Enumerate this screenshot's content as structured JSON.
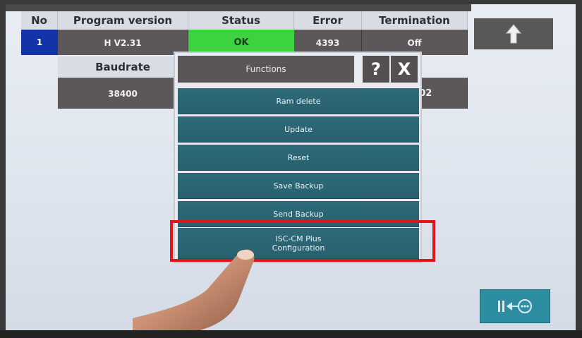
{
  "table": {
    "headers": {
      "no": "No",
      "program_version": "Program version",
      "status": "Status",
      "error": "Error",
      "termination": "Termination"
    },
    "row": {
      "no": "1",
      "program_version": "H V2.31",
      "status": "OK",
      "error": "4393",
      "termination": "Off"
    },
    "baudrate_header": "Baudrate",
    "baudrate_value": "38400",
    "partial_value": ":02"
  },
  "dialog": {
    "title": "Functions",
    "help_label": "?",
    "close_label": "X",
    "buttons": [
      {
        "label": "Ram delete"
      },
      {
        "label": "Update"
      },
      {
        "label": "Reset"
      },
      {
        "label": "Save Backup"
      },
      {
        "label": "Send Backup"
      },
      {
        "label_line1": "ISC-CM Plus",
        "label_line2": "Configuration"
      }
    ]
  },
  "colors": {
    "highlight": "#e0141b",
    "status_ok": "#3dd23f",
    "function_button": "#2f6b7a",
    "no_cell": "#1234a8"
  },
  "icons": {
    "up": "arrow-up-icon",
    "io": "io-connection-icon"
  }
}
